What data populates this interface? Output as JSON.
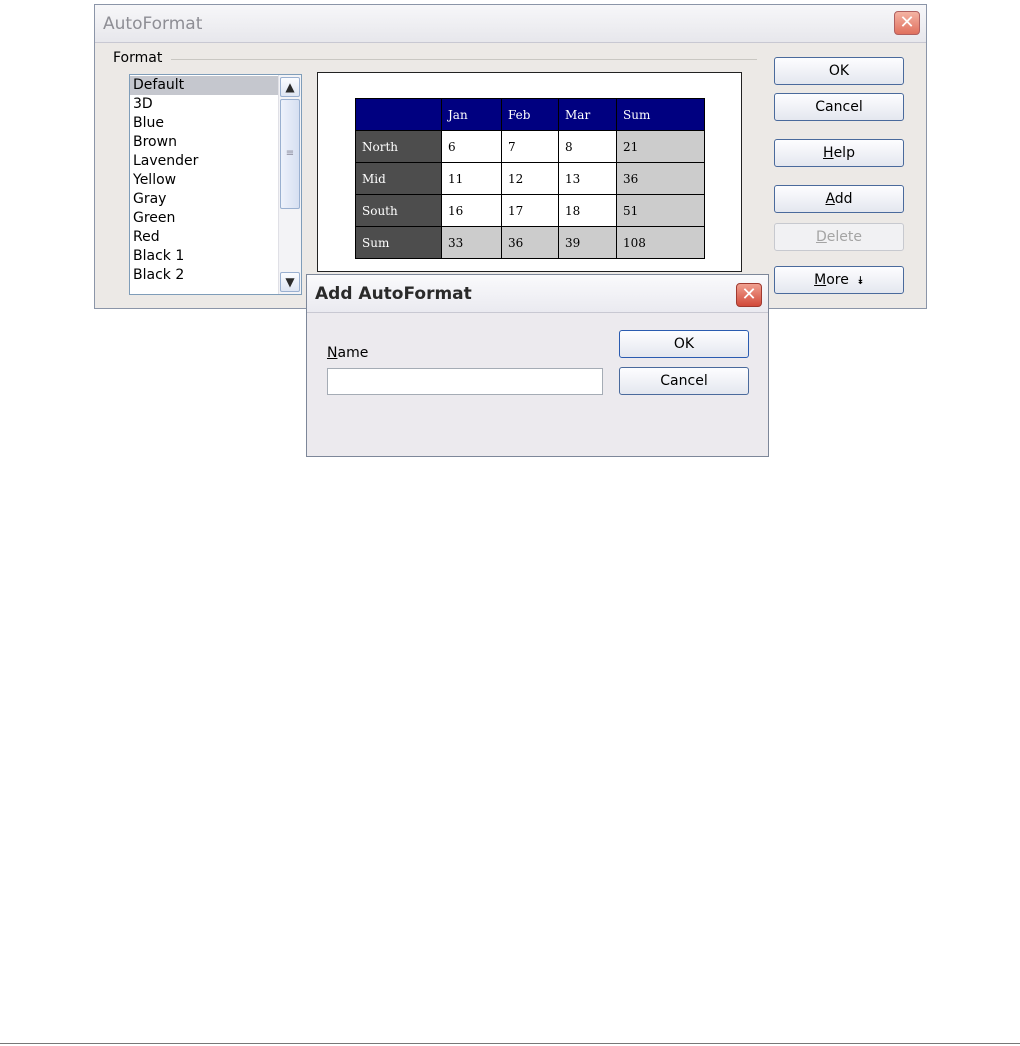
{
  "autoformat_dialog": {
    "title": "AutoFormat",
    "format_group_label": "Format",
    "formats": [
      "Default",
      "3D",
      "Blue",
      "Brown",
      "Lavender",
      "Yellow",
      "Gray",
      "Green",
      "Red",
      "Black 1",
      "Black 2"
    ],
    "selected_format": "Default",
    "buttons": {
      "ok": "OK",
      "cancel": "Cancel",
      "help_underlined": "H",
      "help_rest": "elp",
      "add_underlined": "A",
      "add_rest": "dd",
      "delete_underlined": "D",
      "delete_rest": "elete",
      "more_underlined": "M",
      "more_rest": "ore",
      "more_icon": "double-chevron-down-icon"
    },
    "preview": {
      "header": [
        "",
        "Jan",
        "Feb",
        "Mar",
        "Sum"
      ],
      "rows": [
        [
          "North",
          "6",
          "7",
          "8",
          "21"
        ],
        [
          "Mid",
          "11",
          "12",
          "13",
          "36"
        ],
        [
          "South",
          "16",
          "17",
          "18",
          "51"
        ],
        [
          "Sum",
          "33",
          "36",
          "39",
          "108"
        ]
      ],
      "colors": {
        "header_bg": "#000080",
        "row_header_bg": "#4d4d4d",
        "sum_bg": "#cccccc"
      }
    }
  },
  "add_autoformat_dialog": {
    "title": "Add AutoFormat",
    "name_label_underlined": "N",
    "name_label_rest": "ame",
    "name_value": "",
    "buttons": {
      "ok": "OK",
      "cancel": "Cancel"
    }
  }
}
